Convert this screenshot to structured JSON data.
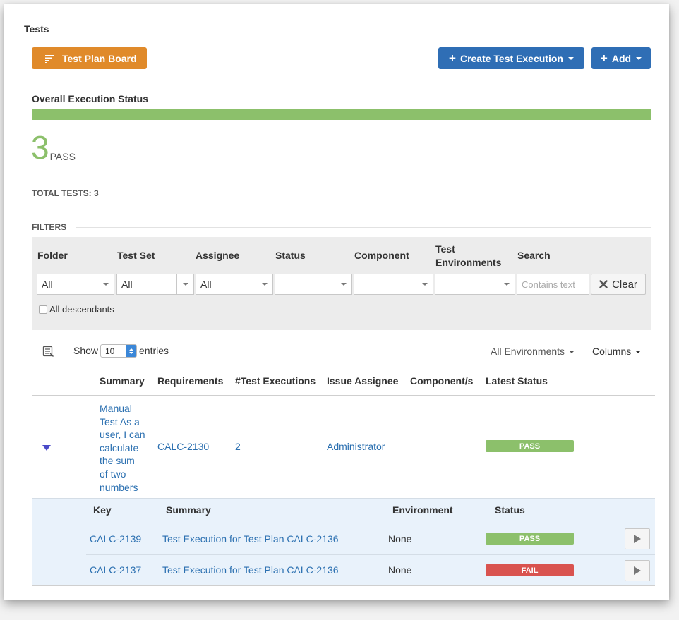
{
  "header": {
    "title": "Tests"
  },
  "toolbar": {
    "board_label": "Test Plan Board",
    "create_label": "Create Test Execution",
    "add_label": "Add",
    "board_icon": "list-sort-icon",
    "plus_icon": "plus-icon"
  },
  "status": {
    "title": "Overall Execution Status",
    "progress_pass": 1.0,
    "count": "3",
    "label": "PASS",
    "total": "TOTAL TESTS: 3",
    "color_pass": "#8cc06b",
    "color_fail": "#d9534f"
  },
  "filters": {
    "title": "FILTERS",
    "labels": {
      "folder": "Folder",
      "test_set": "Test Set",
      "assignee": "Assignee",
      "status": "Status",
      "component": "Component",
      "test_env": "Test Environments",
      "search": "Search"
    },
    "values": {
      "folder": "All",
      "test_set": "All",
      "assignee": "All",
      "status": "",
      "component": "",
      "test_env": ""
    },
    "search_placeholder": "Contains text",
    "clear_label": "Clear",
    "descendants_label": "All descendants"
  },
  "table_controls": {
    "show_label": "Show",
    "entries_value": "10",
    "entries_label": "entries",
    "environments_label": "All Environments",
    "columns_label": "Columns"
  },
  "tests_table": {
    "headers": [
      "Summary",
      "Requirements",
      "#Test Executions",
      "Issue Assignee",
      "Component/s",
      "Latest Status"
    ],
    "rows": [
      {
        "summary_lines": [
          "Manual",
          "Test As a",
          "user, I can",
          "calculate",
          "the sum",
          "of two",
          "numbers"
        ],
        "requirements": "CALC-2130",
        "executions": "2",
        "assignee": "Administrator",
        "components": "",
        "status": "PASS"
      }
    ]
  },
  "executions_table": {
    "headers": [
      "Key",
      "Summary",
      "Environment",
      "Status"
    ],
    "rows": [
      {
        "key": "CALC-2139",
        "summary": "Test Execution for Test Plan CALC-2136",
        "environment": "None",
        "status": "PASS"
      },
      {
        "key": "CALC-2137",
        "summary": "Test Execution for Test Plan CALC-2136",
        "environment": "None",
        "status": "FAIL"
      }
    ]
  }
}
